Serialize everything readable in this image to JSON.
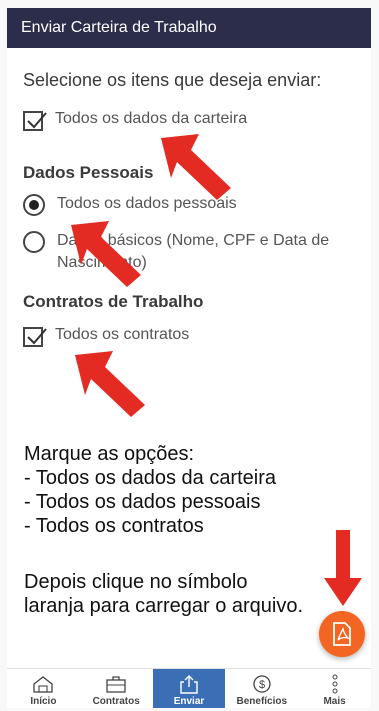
{
  "header": {
    "title": "Enviar Carteira de Trabalho"
  },
  "instruction": "Selecione os itens que deseja enviar:",
  "options": {
    "all_wallet": {
      "label": "Todos os dados da carteira",
      "checked": true
    }
  },
  "personal": {
    "title": "Dados Pessoais",
    "all_label": "Todos os dados pessoais",
    "basic_line1": "Dados básicos (Nome, CPF e Data de",
    "basic_line2": "Nascimento)",
    "selected": "all"
  },
  "contracts": {
    "title": "Contratos de Trabalho",
    "all_label": "Todos os contratos",
    "checked": true
  },
  "note": {
    "line1": "Marque as opções:",
    "line2": "- Todos os dados da carteira",
    "line3": "- Todos os dados pessoais",
    "line4": "- Todos os contratos",
    "line5": "Depois clique no símbolo",
    "line6": "laranja para carregar o arquivo."
  },
  "fab": {
    "icon": "pdf-icon",
    "color": "#f26522"
  },
  "nav": {
    "items": [
      {
        "label": "Início",
        "icon": "home-icon"
      },
      {
        "label": "Contratos",
        "icon": "briefcase-icon"
      },
      {
        "label": "Enviar",
        "icon": "share-icon",
        "active": true
      },
      {
        "label": "Benefícios",
        "icon": "dollar-icon"
      },
      {
        "label": "Mais",
        "icon": "more-icon"
      }
    ]
  },
  "colors": {
    "header": "#2b2d4a",
    "accent": "#f26522",
    "nav_active": "#3a6fb5",
    "annotation_arrow": "#e32b24"
  }
}
